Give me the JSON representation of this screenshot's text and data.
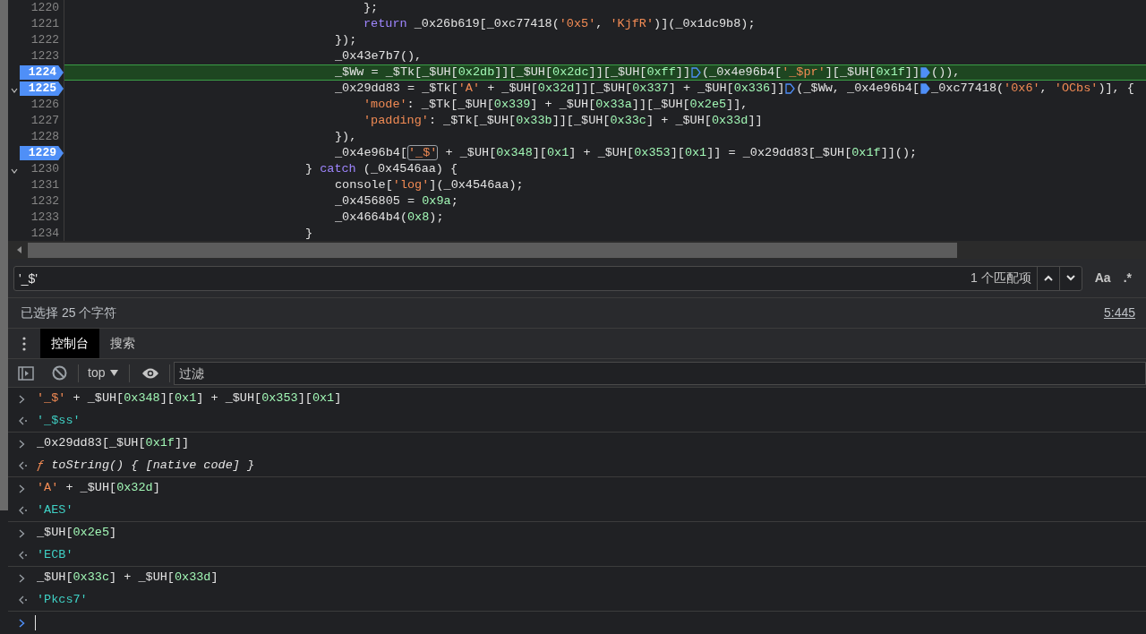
{
  "editor": {
    "lines": [
      {
        "number": "1220",
        "breakpoint": false,
        "current": false,
        "foldable": false,
        "kind": "inner",
        "tokens": [
          {
            "t": "};",
            "kind": "plain"
          }
        ]
      },
      {
        "number": "1221",
        "breakpoint": false,
        "current": false,
        "foldable": false,
        "kind": "inner",
        "tokens": [
          {
            "t": "return",
            "kind": "kw"
          },
          {
            "t": " _0x26b619[_0xc77418(",
            "kind": "plain"
          },
          {
            "t": "'0x5'",
            "kind": "str"
          },
          {
            "t": ", ",
            "kind": "plain"
          },
          {
            "t": "'KjfR'",
            "kind": "str"
          },
          {
            "t": ")](_0x1dc9b8);",
            "kind": "plain"
          }
        ]
      },
      {
        "number": "1222",
        "breakpoint": false,
        "current": false,
        "foldable": false,
        "kind": "block",
        "tokens": [
          {
            "t": "});",
            "kind": "plain"
          }
        ]
      },
      {
        "number": "1223",
        "breakpoint": false,
        "current": false,
        "foldable": false,
        "kind": "block",
        "tokens": [
          {
            "t": "_0x43e7b7(),",
            "kind": "plain"
          }
        ]
      },
      {
        "number": "1224",
        "breakpoint": true,
        "current": true,
        "foldable": false,
        "kind": "block",
        "tokens": [
          {
            "t": "_$Ww = _$Tk[_$UH[",
            "kind": "plain"
          },
          {
            "t": "0x2db",
            "kind": "num"
          },
          {
            "t": "]][_$UH[",
            "kind": "plain"
          },
          {
            "t": "0x2dc",
            "kind": "num"
          },
          {
            "t": "]][_$UH[",
            "kind": "plain"
          },
          {
            "t": "0xff",
            "kind": "num"
          },
          {
            "t": "]]",
            "kind": "plain"
          },
          {
            "kind": "marker",
            "active": false
          },
          {
            "t": "(_0x4e96b4[",
            "kind": "plain"
          },
          {
            "t": "'_$pr'",
            "kind": "str"
          },
          {
            "t": "][_$UH[",
            "kind": "plain"
          },
          {
            "t": "0x1f",
            "kind": "num"
          },
          {
            "t": "]]",
            "kind": "plain"
          },
          {
            "kind": "marker",
            "active": true
          },
          {
            "t": "()),",
            "kind": "plain"
          }
        ]
      },
      {
        "number": "1225",
        "breakpoint": true,
        "current": false,
        "foldable": true,
        "kind": "block",
        "tokens": [
          {
            "t": "_0x29dd83 = _$Tk[",
            "kind": "plain"
          },
          {
            "t": "'A'",
            "kind": "str"
          },
          {
            "t": " + _$UH[",
            "kind": "plain"
          },
          {
            "t": "0x32d",
            "kind": "num"
          },
          {
            "t": "]][_$UH[",
            "kind": "plain"
          },
          {
            "t": "0x337",
            "kind": "num"
          },
          {
            "t": "] + _$UH[",
            "kind": "plain"
          },
          {
            "t": "0x336",
            "kind": "num"
          },
          {
            "t": "]]",
            "kind": "plain"
          },
          {
            "kind": "marker",
            "active": false
          },
          {
            "t": "(_$Ww, _0x4e96b4[",
            "kind": "plain"
          },
          {
            "kind": "marker",
            "active": true
          },
          {
            "t": "_0xc77418(",
            "kind": "plain"
          },
          {
            "t": "'0x6'",
            "kind": "str"
          },
          {
            "t": ", ",
            "kind": "plain"
          },
          {
            "t": "'OCbs'",
            "kind": "str"
          },
          {
            "t": ")], {",
            "kind": "plain"
          }
        ]
      },
      {
        "number": "1226",
        "breakpoint": false,
        "current": false,
        "foldable": false,
        "kind": "inner",
        "tokens": [
          {
            "t": "'mode'",
            "kind": "str"
          },
          {
            "t": ": _$Tk[_$UH[",
            "kind": "plain"
          },
          {
            "t": "0x339",
            "kind": "num"
          },
          {
            "t": "] + _$UH[",
            "kind": "plain"
          },
          {
            "t": "0x33a",
            "kind": "num"
          },
          {
            "t": "]][_$UH[",
            "kind": "plain"
          },
          {
            "t": "0x2e5",
            "kind": "num"
          },
          {
            "t": "]],",
            "kind": "plain"
          }
        ]
      },
      {
        "number": "1227",
        "breakpoint": false,
        "current": false,
        "foldable": false,
        "kind": "inner",
        "tokens": [
          {
            "t": "'padding'",
            "kind": "str"
          },
          {
            "t": ": _$Tk[_$UH[",
            "kind": "plain"
          },
          {
            "t": "0x33b",
            "kind": "num"
          },
          {
            "t": "]][_$UH[",
            "kind": "plain"
          },
          {
            "t": "0x33c",
            "kind": "num"
          },
          {
            "t": "] + _$UH[",
            "kind": "plain"
          },
          {
            "t": "0x33d",
            "kind": "num"
          },
          {
            "t": "]]",
            "kind": "plain"
          }
        ]
      },
      {
        "number": "1228",
        "breakpoint": false,
        "current": false,
        "foldable": false,
        "kind": "block",
        "tokens": [
          {
            "t": "}),",
            "kind": "plain"
          }
        ]
      },
      {
        "number": "1229",
        "breakpoint": true,
        "current": false,
        "foldable": false,
        "kind": "block",
        "tokens": [
          {
            "t": "_0x4e96b4[",
            "kind": "plain"
          },
          {
            "t": "'_$'",
            "kind": "str",
            "match": true
          },
          {
            "t": " + _$UH[",
            "kind": "plain"
          },
          {
            "t": "0x348",
            "kind": "num"
          },
          {
            "t": "][",
            "kind": "plain"
          },
          {
            "t": "0x1",
            "kind": "num"
          },
          {
            "t": "] + _$UH[",
            "kind": "plain"
          },
          {
            "t": "0x353",
            "kind": "num"
          },
          {
            "t": "][",
            "kind": "plain"
          },
          {
            "t": "0x1",
            "kind": "num"
          },
          {
            "t": "]] = _0x29dd83[_$UH[",
            "kind": "plain"
          },
          {
            "t": "0x1f",
            "kind": "num"
          },
          {
            "t": "]]();",
            "kind": "plain"
          }
        ]
      },
      {
        "number": "1230",
        "breakpoint": false,
        "current": false,
        "foldable": true,
        "kind": "outer",
        "tokens": [
          {
            "t": "} ",
            "kind": "plain"
          },
          {
            "t": "catch",
            "kind": "kw"
          },
          {
            "t": " (_0x4546aa) {",
            "kind": "plain"
          }
        ]
      },
      {
        "number": "1231",
        "breakpoint": false,
        "current": false,
        "foldable": false,
        "kind": "block",
        "tokens": [
          {
            "t": "console[",
            "kind": "plain"
          },
          {
            "t": "'log'",
            "kind": "str"
          },
          {
            "t": "](_0x4546aa);",
            "kind": "plain"
          }
        ]
      },
      {
        "number": "1232",
        "breakpoint": false,
        "current": false,
        "foldable": false,
        "kind": "block",
        "tokens": [
          {
            "t": "_0x456805 = ",
            "kind": "plain"
          },
          {
            "t": "0x9a",
            "kind": "num"
          },
          {
            "t": ";",
            "kind": "plain"
          }
        ]
      },
      {
        "number": "1233",
        "breakpoint": false,
        "current": false,
        "foldable": false,
        "kind": "block",
        "tokens": [
          {
            "t": "_0x4664b4(",
            "kind": "plain"
          },
          {
            "t": "0x8",
            "kind": "num"
          },
          {
            "t": ");",
            "kind": "plain"
          }
        ]
      },
      {
        "number": "1234",
        "breakpoint": false,
        "current": false,
        "foldable": false,
        "kind": "outer",
        "tokens": [
          {
            "t": "}",
            "kind": "plain"
          }
        ]
      }
    ]
  },
  "search": {
    "value": "'_$'",
    "match_count": "1 个匹配项",
    "case_button": "Aa",
    "regex_button": ".*"
  },
  "status": {
    "selection": "已选择 25 个字符",
    "position": "5:445"
  },
  "drawer_tabs": [
    {
      "label": "控制台",
      "selected": true
    },
    {
      "label": "搜索",
      "selected": false
    }
  ],
  "toolbar": {
    "context": "top",
    "filter_placeholder": "过滤"
  },
  "console": [
    {
      "kind": "input",
      "tokens": [
        {
          "t": "'_$'",
          "kind": "str"
        },
        {
          "t": " + _$UH[",
          "kind": "plain"
        },
        {
          "t": "0x348",
          "kind": "num"
        },
        {
          "t": "][",
          "kind": "plain"
        },
        {
          "t": "0x1",
          "kind": "num"
        },
        {
          "t": "] + _$UH[",
          "kind": "plain"
        },
        {
          "t": "0x353",
          "kind": "num"
        },
        {
          "t": "][",
          "kind": "plain"
        },
        {
          "t": "0x1",
          "kind": "num"
        },
        {
          "t": "]",
          "kind": "plain"
        }
      ]
    },
    {
      "kind": "result",
      "tokens": [
        {
          "t": "'_$ss'",
          "kind": "res"
        }
      ]
    },
    {
      "kind": "input",
      "tokens": [
        {
          "t": "_0x29dd83[_$UH[",
          "kind": "plain"
        },
        {
          "t": "0x1f",
          "kind": "num"
        },
        {
          "t": "]]",
          "kind": "plain"
        }
      ]
    },
    {
      "kind": "result",
      "tokens": [
        {
          "t": "ƒ",
          "kind": "fn"
        },
        {
          "t": " toString() { [native code] }",
          "kind": "italic"
        }
      ]
    },
    {
      "kind": "input",
      "tokens": [
        {
          "t": "'A'",
          "kind": "str"
        },
        {
          "t": " + _$UH[",
          "kind": "plain"
        },
        {
          "t": "0x32d",
          "kind": "num"
        },
        {
          "t": "]",
          "kind": "plain"
        }
      ]
    },
    {
      "kind": "result",
      "tokens": [
        {
          "t": "'AES'",
          "kind": "res"
        }
      ]
    },
    {
      "kind": "input",
      "tokens": [
        {
          "t": "_$UH[",
          "kind": "plain"
        },
        {
          "t": "0x2e5",
          "kind": "num"
        },
        {
          "t": "]",
          "kind": "plain"
        }
      ]
    },
    {
      "kind": "result",
      "tokens": [
        {
          "t": "'ECB'",
          "kind": "res"
        }
      ]
    },
    {
      "kind": "input",
      "tokens": [
        {
          "t": "_$UH[",
          "kind": "plain"
        },
        {
          "t": "0x33c",
          "kind": "num"
        },
        {
          "t": "] + _$UH[",
          "kind": "plain"
        },
        {
          "t": "0x33d",
          "kind": "num"
        },
        {
          "t": "]",
          "kind": "plain"
        }
      ]
    },
    {
      "kind": "result",
      "tokens": [
        {
          "t": "'Pkcs7'",
          "kind": "res"
        }
      ]
    }
  ]
}
